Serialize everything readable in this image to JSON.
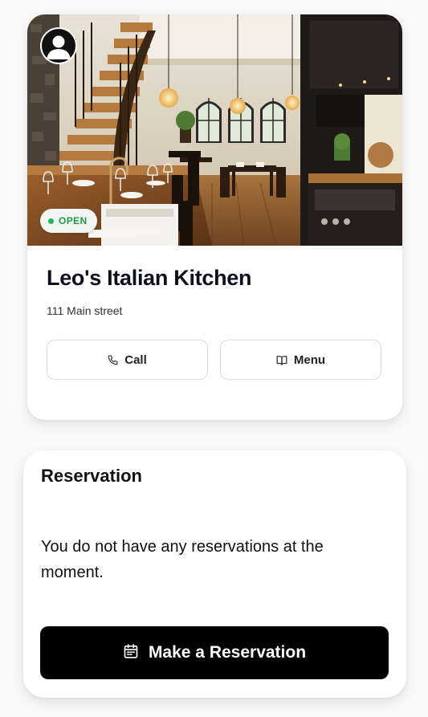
{
  "restaurant": {
    "status": "OPEN",
    "name": "Leo's Italian Kitchen",
    "address": "111 Main street",
    "actions": {
      "call_label": "Call",
      "menu_label": "Menu"
    },
    "status_color": "#1fb55a"
  },
  "reservation": {
    "title": "Reservation",
    "empty_message": "You do not have any reservations at the moment.",
    "button_label": "Make a Reservation"
  },
  "icons": {
    "avatar": "user-avatar-icon",
    "call": "phone-icon",
    "menu": "book-open-icon",
    "reserve": "calendar-icon"
  }
}
